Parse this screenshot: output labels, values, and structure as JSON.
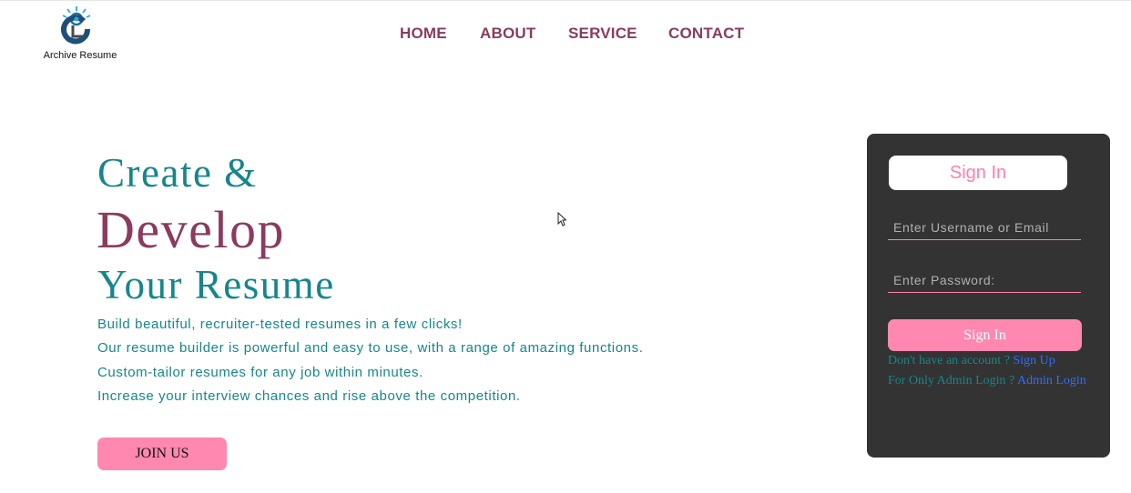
{
  "brand": {
    "logo_icon": "lightbulb-c-logo-icon",
    "name": "Archive Resume"
  },
  "nav": {
    "home": "HOME",
    "about": "ABOUT",
    "service": "SERVICE",
    "contact": "CONTACT"
  },
  "hero": {
    "line1": "Create &",
    "line2": "Develop",
    "line3": "Your Resume",
    "descriptions": [
      "Build beautiful, recruiter-tested resumes in a few clicks!",
      "Our resume builder is powerful and easy to use, with a range of amazing functions.",
      "Custom-tailor resumes for any job within minutes.",
      "Increase your interview chances and rise above the competition."
    ],
    "join_label": "JOIN US"
  },
  "signin": {
    "title": "Sign In",
    "username_placeholder": "Enter Username or Email",
    "password_placeholder": "Enter Password:",
    "button_label": "Sign In",
    "no_account_text": "Don't have an account ?",
    "signup_link": "Sign Up",
    "admin_text": "For Only Admin Login ?",
    "admin_link": "Admin Login"
  },
  "colors": {
    "teal": "#16868a",
    "maroon": "#8a3b5e",
    "pink": "#ff88b0",
    "panel_bg": "#333333",
    "link_blue": "#2f6dff"
  }
}
